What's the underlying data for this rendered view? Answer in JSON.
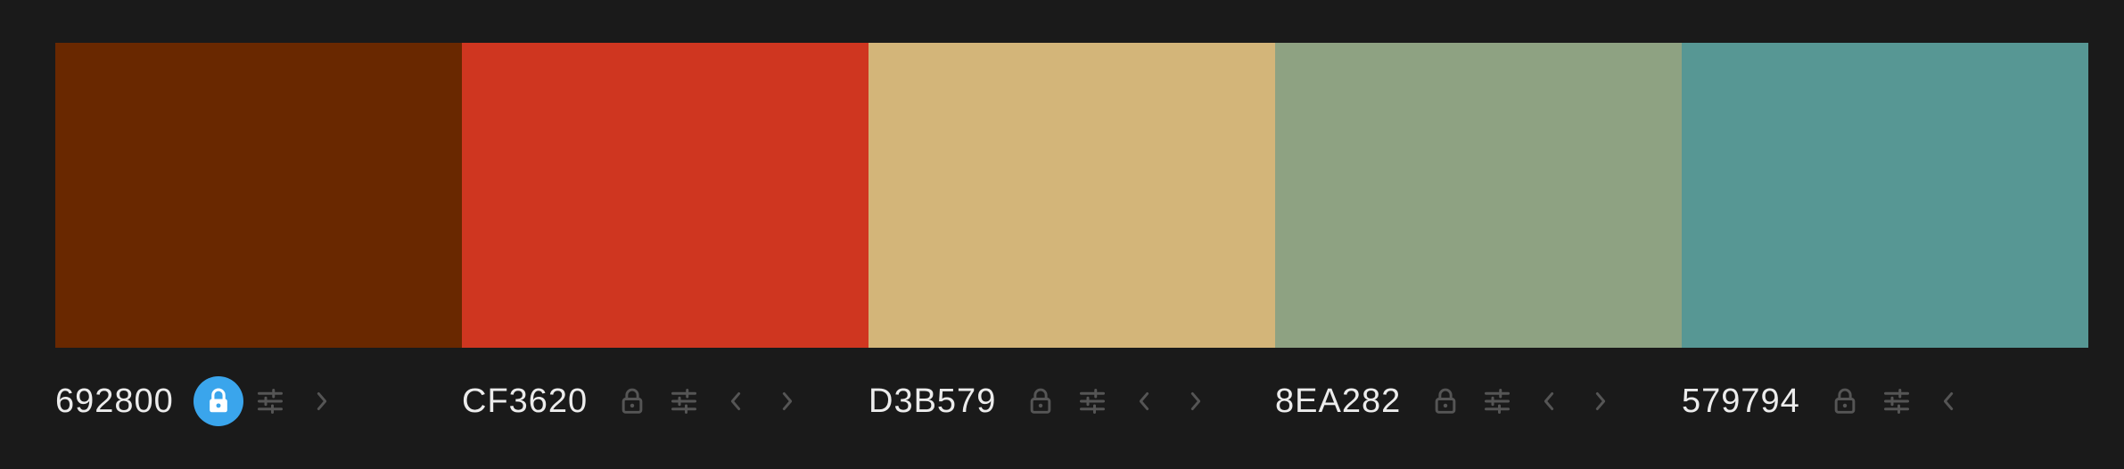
{
  "palette": {
    "colors": [
      {
        "hex": "692800",
        "swatch_color": "#692800",
        "locked": true,
        "icons": [
          "lock-icon",
          "adjust-icon",
          "chevron-right-icon"
        ]
      },
      {
        "hex": "CF3620",
        "swatch_color": "#CF3620",
        "locked": false,
        "icons": [
          "lock-icon",
          "adjust-icon",
          "chevron-left-icon",
          "chevron-right-icon"
        ]
      },
      {
        "hex": "D3B579",
        "swatch_color": "#D3B579",
        "locked": false,
        "icons": [
          "lock-icon",
          "adjust-icon",
          "chevron-left-icon",
          "chevron-right-icon"
        ]
      },
      {
        "hex": "8EA282",
        "swatch_color": "#8EA282",
        "locked": false,
        "icons": [
          "lock-icon",
          "adjust-icon",
          "chevron-left-icon",
          "chevron-right-icon"
        ]
      },
      {
        "hex": "579794",
        "swatch_color": "#579794",
        "locked": false,
        "icons": [
          "lock-icon",
          "adjust-icon",
          "chevron-left-icon"
        ]
      }
    ]
  },
  "theme": {
    "background": "#1a1a1a",
    "text": "#ececec",
    "icon_muted": "#555555",
    "lock_active": "#3aa5ec"
  }
}
